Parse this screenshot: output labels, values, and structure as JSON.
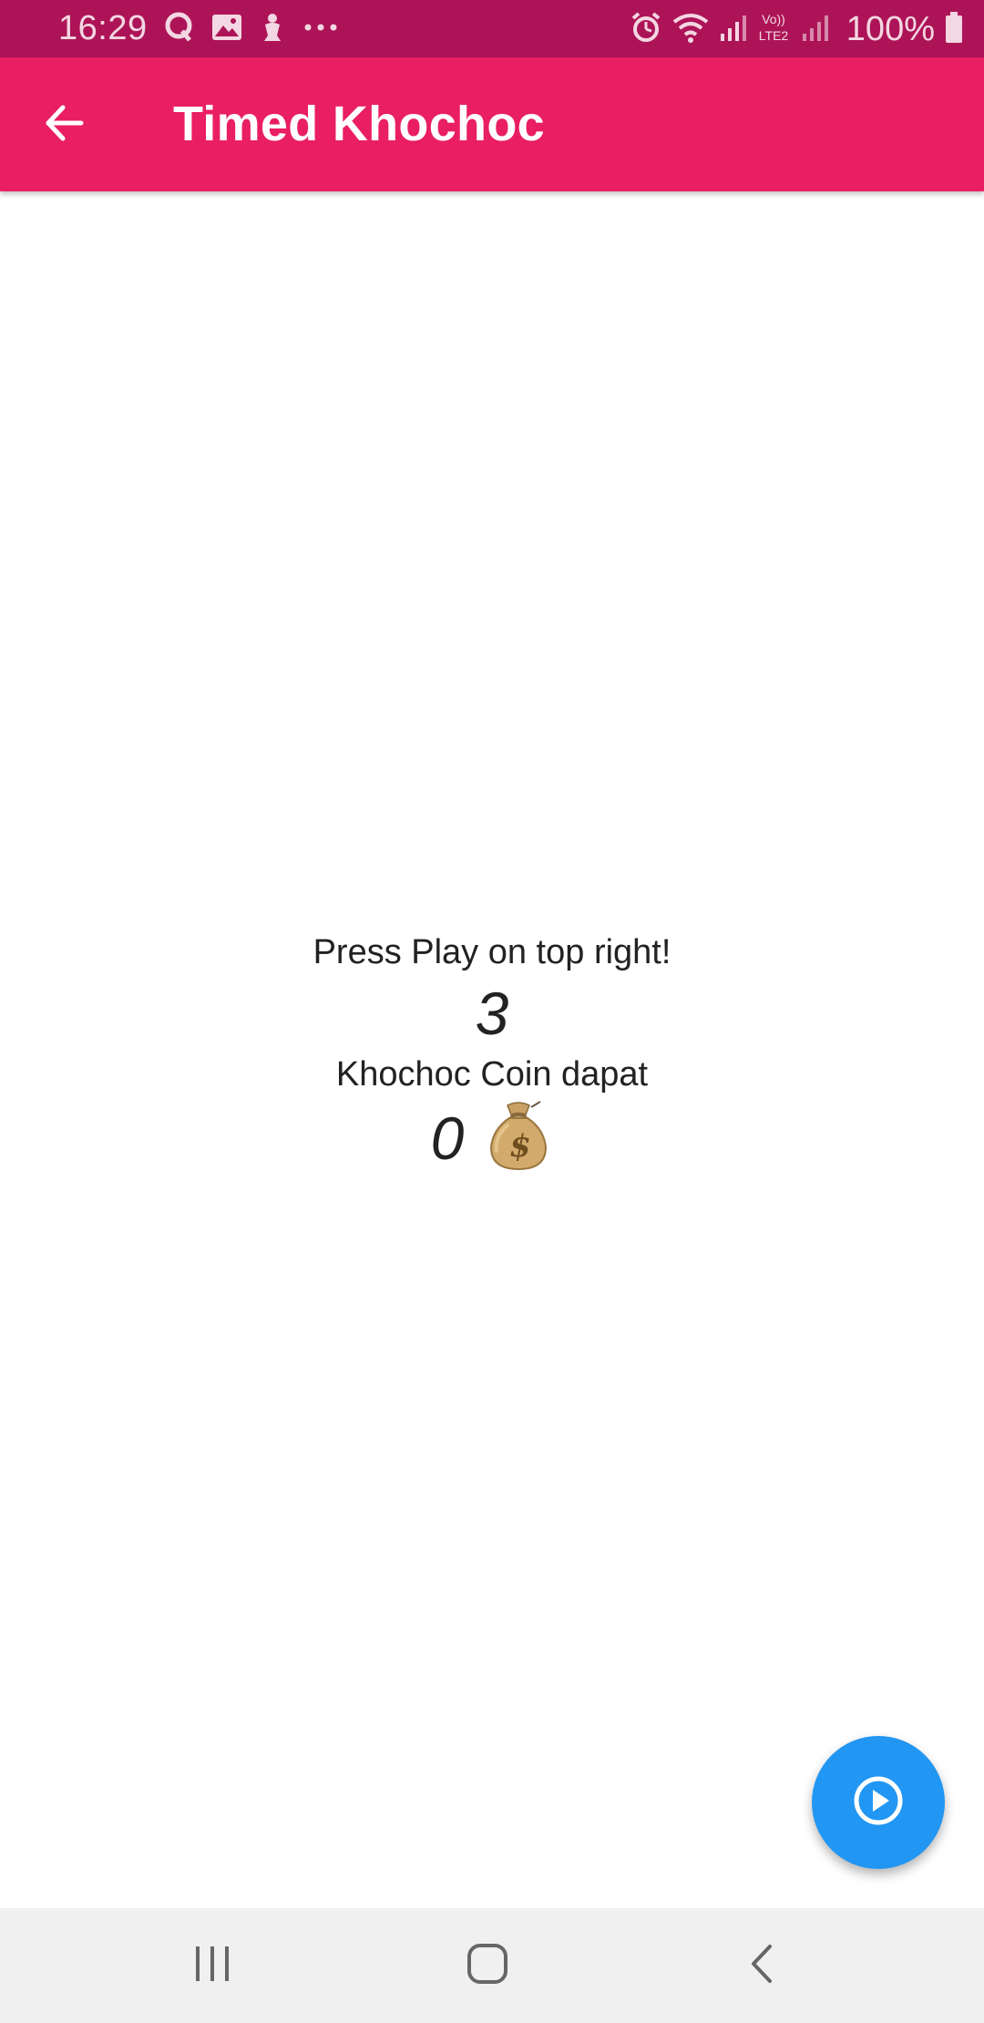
{
  "status_bar": {
    "time": "16:29",
    "battery": "100%",
    "icons": [
      "q-app-icon",
      "gallery-icon",
      "notification-icon",
      "more-dots-icon",
      "alarm-icon",
      "wifi-icon",
      "signal-icon",
      "volte-lte2-icon",
      "signal2-icon",
      "battery-icon"
    ]
  },
  "app_bar": {
    "title": "Timed Khochoc",
    "back_icon": "arrow-back-icon",
    "color": "#E91E63"
  },
  "main": {
    "prompt": "Press Play on top right!",
    "countdown": "3",
    "coins_label": "Khochoc Coin dapat",
    "coins_value": "0",
    "coins_icon": "money-bag-icon"
  },
  "fab": {
    "icon": "play-circle-icon",
    "color": "#2196F3"
  },
  "nav_bar": {
    "icons": [
      "recent-apps-icon",
      "home-icon",
      "back-icon"
    ]
  },
  "colors": {
    "status_bar": "#AD1457",
    "app_bar": "#E91E63",
    "fab": "#2196F3",
    "text": "#222222"
  }
}
